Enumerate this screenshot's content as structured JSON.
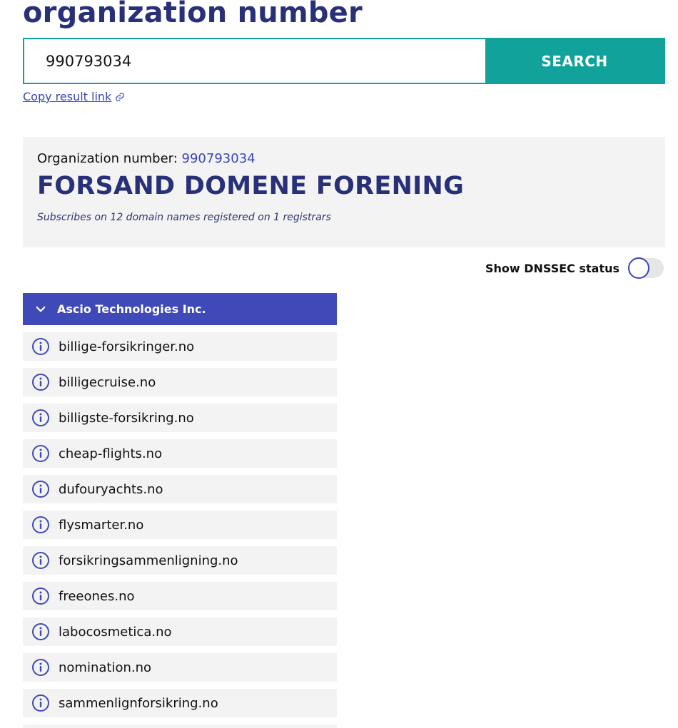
{
  "header": {
    "title": "organization number"
  },
  "search": {
    "value": "990793034",
    "button_label": "SEARCH"
  },
  "copy_link": {
    "label": "Copy result link"
  },
  "organization": {
    "number_label": "Organization number: ",
    "number": "990793034",
    "name": "FORSAND DOMENE FORENING",
    "subtitle": "Subscribes on 12 domain names registered on 1 registrars"
  },
  "dnssec": {
    "label": "Show DNSSEC status",
    "enabled": false
  },
  "registrar": {
    "name": "Ascio Technologies Inc.",
    "expanded": true,
    "domains": [
      "billige-forsikringer.no",
      "billigecruise.no",
      "billigste-forsikring.no",
      "cheap-flights.no",
      "dufouryachts.no",
      "flysmarter.no",
      "forsikringsammenligning.no",
      "freeones.no",
      "labocosmetica.no",
      "nomination.no",
      "sammenlignforsikring.no",
      ""
    ]
  },
  "colors": {
    "brand_dark": "#28307a",
    "accent_teal": "#10a29b",
    "accent_blue": "#3f49b8",
    "panel_bg": "#f3f3f3"
  },
  "icons": {
    "copy_link": "link-icon",
    "registrar_toggle": "chevron-down-icon",
    "domain_info": "info-icon"
  }
}
